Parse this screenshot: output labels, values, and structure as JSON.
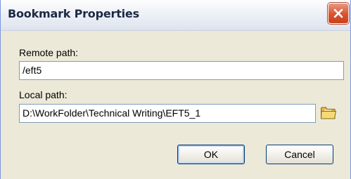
{
  "window": {
    "title": "Bookmark Properties"
  },
  "form": {
    "remote_path_label": "Remote path:",
    "remote_path_value": "/eft5",
    "local_path_label": "Local path:",
    "local_path_value": "D:\\WorkFolder\\Technical Writing\\EFT5_1"
  },
  "buttons": {
    "ok_label": "OK",
    "cancel_label": "Cancel"
  },
  "icons": {
    "close": "close-icon",
    "browse": "folder-icon"
  },
  "colors": {
    "dialog_bg": "#ece9d8",
    "close_button": "#d9532f",
    "field_border": "#7f9db9",
    "button_border": "#003c74"
  }
}
